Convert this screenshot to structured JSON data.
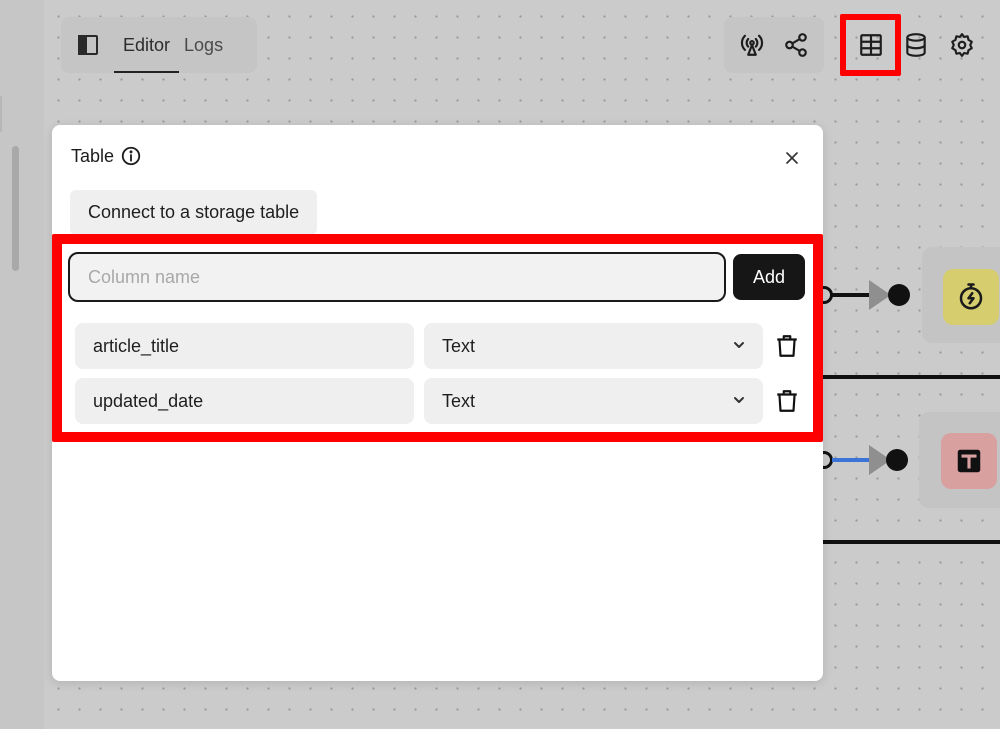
{
  "toolbar": {
    "tabs": [
      {
        "label": "Editor",
        "active": true
      },
      {
        "label": "Logs",
        "active": false
      }
    ],
    "icons": [
      "sidebar-panel-icon",
      "broadcast-icon",
      "share-icon",
      "table-icon",
      "database-icon",
      "settings-gear-icon"
    ]
  },
  "dialog": {
    "title": "Table",
    "connect_label": "Connect to a storage table",
    "column_input": {
      "placeholder": "Column name",
      "value": ""
    },
    "add_label": "Add",
    "columns": [
      {
        "name": "article_title",
        "type": "Text"
      },
      {
        "name": "updated_date",
        "type": "Text"
      }
    ]
  },
  "canvas_nodes": [
    {
      "icon": "stopwatch-bolt-icon",
      "color": "#d6cd6f"
    },
    {
      "icon": "table-add-icon",
      "color": "#d9a0a0"
    }
  ],
  "colors": {
    "highlight": "#ff0000",
    "edge_blue": "#3b74d6",
    "button_dark": "#161616"
  }
}
